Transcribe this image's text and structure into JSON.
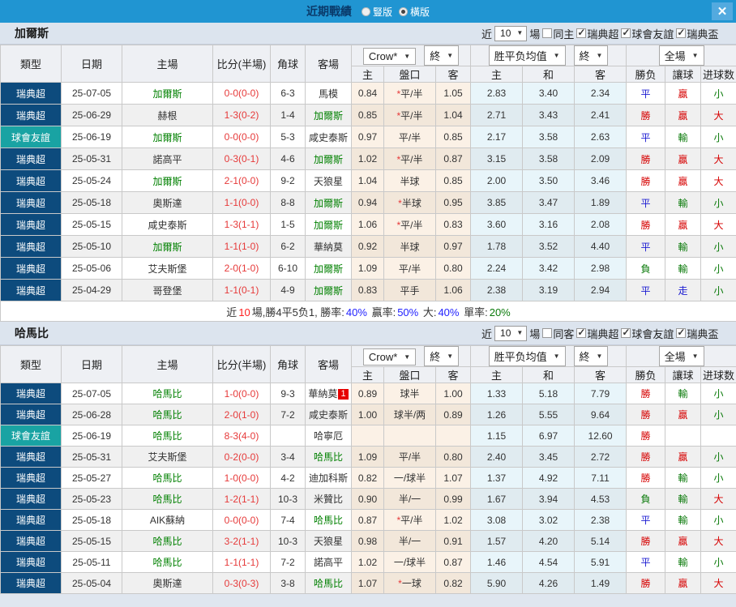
{
  "topbar": {
    "title": "近期戰績",
    "vertical": {
      "label": "豎版",
      "selected": false
    },
    "horizontal": {
      "label": "橫版",
      "selected": true
    },
    "close": "✕"
  },
  "colors": {
    "topbar_bg": "#2095d2",
    "league_super_bg": "#0d4b7d",
    "league_friendly_bg": "#19a3a3",
    "focus_team": "#008000",
    "score": "#e63939",
    "win_red": "#d60000",
    "draw_blue": "#1b1bd2",
    "lose_green": "#0a7a0a"
  },
  "table": {
    "near": "近",
    "matches": "10",
    "unit": "場",
    "odds_src": "Crow*",
    "final": "終",
    "avg": "胜平负均值",
    "scope": "全場",
    "cols": {
      "league": "類型",
      "date": "日期",
      "home": "主場",
      "score": "比分(半場)",
      "corners": "角球",
      "away": "客場",
      "o_home": "主",
      "o_line": "盤口",
      "o_away": "客",
      "a_home": "主",
      "a_draw": "和",
      "a_away": "客",
      "r_wdl": "勝负",
      "r_handicap": "讓球",
      "r_goals": "进球数"
    }
  },
  "sections": [
    {
      "team": "加爾斯",
      "same_side": "同主",
      "same_checked": false,
      "leagues": [
        {
          "label": "瑞典超",
          "checked": true
        },
        {
          "label": "球會友誼",
          "checked": true
        },
        {
          "label": "瑞典盃",
          "checked": true
        }
      ],
      "rows": [
        {
          "league": "瑞典超",
          "league_type": "super",
          "date": "25-07-05",
          "home": "加爾斯",
          "home_focus": true,
          "score": "0-0(0-0)",
          "corners": "6-3",
          "away": "馬模",
          "away_focus": false,
          "away_badge": "",
          "odds_home": "0.84",
          "line": "*平/半",
          "odds_away": "1.05",
          "avg_home": "2.83",
          "avg_draw": "3.40",
          "avg_away": "2.34",
          "r_wdl": "平",
          "r_wdl_color": "blue",
          "r_handicap": "贏",
          "r_handicap_color": "red",
          "r_goals": "小",
          "r_goals_color": "green"
        },
        {
          "league": "瑞典超",
          "league_type": "super",
          "date": "25-06-29",
          "home": "赫根",
          "home_focus": false,
          "score": "1-3(0-2)",
          "corners": "1-4",
          "away": "加爾斯",
          "away_focus": true,
          "away_badge": "",
          "odds_home": "0.85",
          "line": "*平/半",
          "odds_away": "1.04",
          "avg_home": "2.71",
          "avg_draw": "3.43",
          "avg_away": "2.41",
          "r_wdl": "勝",
          "r_wdl_color": "red",
          "r_handicap": "贏",
          "r_handicap_color": "red",
          "r_goals": "大",
          "r_goals_color": "red"
        },
        {
          "league": "球會友誼",
          "league_type": "friendly",
          "date": "25-06-19",
          "home": "加爾斯",
          "home_focus": true,
          "score": "0-0(0-0)",
          "corners": "5-3",
          "away": "咸史泰斯",
          "away_focus": false,
          "away_badge": "",
          "odds_home": "0.97",
          "line": "平/半",
          "odds_away": "0.85",
          "avg_home": "2.17",
          "avg_draw": "3.58",
          "avg_away": "2.63",
          "r_wdl": "平",
          "r_wdl_color": "blue",
          "r_handicap": "輸",
          "r_handicap_color": "green",
          "r_goals": "小",
          "r_goals_color": "green"
        },
        {
          "league": "瑞典超",
          "league_type": "super",
          "date": "25-05-31",
          "home": "諾高平",
          "home_focus": false,
          "score": "0-3(0-1)",
          "corners": "4-6",
          "away": "加爾斯",
          "away_focus": true,
          "away_badge": "",
          "odds_home": "1.02",
          "line": "*平/半",
          "odds_away": "0.87",
          "avg_home": "3.15",
          "avg_draw": "3.58",
          "avg_away": "2.09",
          "r_wdl": "勝",
          "r_wdl_color": "red",
          "r_handicap": "贏",
          "r_handicap_color": "red",
          "r_goals": "大",
          "r_goals_color": "red"
        },
        {
          "league": "瑞典超",
          "league_type": "super",
          "date": "25-05-24",
          "home": "加爾斯",
          "home_focus": true,
          "score": "2-1(0-0)",
          "corners": "9-2",
          "away": "天狼星",
          "away_focus": false,
          "away_badge": "",
          "odds_home": "1.04",
          "line": "半球",
          "odds_away": "0.85",
          "avg_home": "2.00",
          "avg_draw": "3.50",
          "avg_away": "3.46",
          "r_wdl": "勝",
          "r_wdl_color": "red",
          "r_handicap": "贏",
          "r_handicap_color": "red",
          "r_goals": "大",
          "r_goals_color": "red"
        },
        {
          "league": "瑞典超",
          "league_type": "super",
          "date": "25-05-18",
          "home": "奧斯達",
          "home_focus": false,
          "score": "1-1(0-0)",
          "corners": "8-8",
          "away": "加爾斯",
          "away_focus": true,
          "away_badge": "",
          "odds_home": "0.94",
          "line": "*半球",
          "odds_away": "0.95",
          "avg_home": "3.85",
          "avg_draw": "3.47",
          "avg_away": "1.89",
          "r_wdl": "平",
          "r_wdl_color": "blue",
          "r_handicap": "輸",
          "r_handicap_color": "green",
          "r_goals": "小",
          "r_goals_color": "green"
        },
        {
          "league": "瑞典超",
          "league_type": "super",
          "date": "25-05-15",
          "home": "咸史泰斯",
          "home_focus": false,
          "score": "1-3(1-1)",
          "corners": "1-5",
          "away": "加爾斯",
          "away_focus": true,
          "away_badge": "",
          "odds_home": "1.06",
          "line": "*平/半",
          "odds_away": "0.83",
          "avg_home": "3.60",
          "avg_draw": "3.16",
          "avg_away": "2.08",
          "r_wdl": "勝",
          "r_wdl_color": "red",
          "r_handicap": "贏",
          "r_handicap_color": "red",
          "r_goals": "大",
          "r_goals_color": "red"
        },
        {
          "league": "瑞典超",
          "league_type": "super",
          "date": "25-05-10",
          "home": "加爾斯",
          "home_focus": true,
          "score": "1-1(1-0)",
          "corners": "6-2",
          "away": "華納莫",
          "away_focus": false,
          "away_badge": "",
          "odds_home": "0.92",
          "line": "半球",
          "odds_away": "0.97",
          "avg_home": "1.78",
          "avg_draw": "3.52",
          "avg_away": "4.40",
          "r_wdl": "平",
          "r_wdl_color": "blue",
          "r_handicap": "輸",
          "r_handicap_color": "green",
          "r_goals": "小",
          "r_goals_color": "green"
        },
        {
          "league": "瑞典超",
          "league_type": "super",
          "date": "25-05-06",
          "home": "艾夫斯堡",
          "home_focus": false,
          "score": "2-0(1-0)",
          "corners": "6-10",
          "away": "加爾斯",
          "away_focus": true,
          "away_badge": "",
          "odds_home": "1.09",
          "line": "平/半",
          "odds_away": "0.80",
          "avg_home": "2.24",
          "avg_draw": "3.42",
          "avg_away": "2.98",
          "r_wdl": "負",
          "r_wdl_color": "green",
          "r_handicap": "輸",
          "r_handicap_color": "green",
          "r_goals": "小",
          "r_goals_color": "green"
        },
        {
          "league": "瑞典超",
          "league_type": "super",
          "date": "25-04-29",
          "home": "哥登堡",
          "home_focus": false,
          "score": "1-1(0-1)",
          "corners": "4-9",
          "away": "加爾斯",
          "away_focus": true,
          "away_badge": "",
          "odds_home": "0.83",
          "line": "平手",
          "odds_away": "1.06",
          "avg_home": "2.38",
          "avg_draw": "3.19",
          "avg_away": "2.94",
          "r_wdl": "平",
          "r_wdl_color": "blue",
          "r_handicap": "走",
          "r_handicap_color": "blue",
          "r_goals": "小",
          "r_goals_color": "green"
        }
      ],
      "summary": [
        {
          "text": "近",
          "color": "#333333"
        },
        {
          "text": "10",
          "color": "#ff2020"
        },
        {
          "text": "場,勝4平5负1, 勝率:",
          "color": "#333333"
        },
        {
          "text": "40%",
          "color": "#2222ff"
        },
        {
          "text": " 贏率:",
          "color": "#333333"
        },
        {
          "text": "50%",
          "color": "#2222ff"
        },
        {
          "text": " 大:",
          "color": "#333333"
        },
        {
          "text": "40%",
          "color": "#2222ff"
        },
        {
          "text": " 單率:",
          "color": "#333333"
        },
        {
          "text": "20%",
          "color": "#0a7a0a"
        }
      ]
    },
    {
      "team": "哈馬比",
      "same_side": "同客",
      "same_checked": false,
      "leagues": [
        {
          "label": "瑞典超",
          "checked": true
        },
        {
          "label": "球會友誼",
          "checked": true
        },
        {
          "label": "瑞典盃",
          "checked": true
        }
      ],
      "rows": [
        {
          "league": "瑞典超",
          "league_type": "super",
          "date": "25-07-05",
          "home": "哈馬比",
          "home_focus": true,
          "score": "1-0(0-0)",
          "corners": "9-3",
          "away": "華納莫",
          "away_focus": false,
          "away_badge": "1",
          "odds_home": "0.89",
          "line": "球半",
          "odds_away": "1.00",
          "avg_home": "1.33",
          "avg_draw": "5.18",
          "avg_away": "7.79",
          "r_wdl": "勝",
          "r_wdl_color": "red",
          "r_handicap": "輸",
          "r_handicap_color": "green",
          "r_goals": "小",
          "r_goals_color": "green"
        },
        {
          "league": "瑞典超",
          "league_type": "super",
          "date": "25-06-28",
          "home": "哈馬比",
          "home_focus": true,
          "score": "2-0(1-0)",
          "corners": "7-2",
          "away": "咸史泰斯",
          "away_focus": false,
          "away_badge": "",
          "odds_home": "1.00",
          "line": "球半/两",
          "odds_away": "0.89",
          "avg_home": "1.26",
          "avg_draw": "5.55",
          "avg_away": "9.64",
          "r_wdl": "勝",
          "r_wdl_color": "red",
          "r_handicap": "贏",
          "r_handicap_color": "red",
          "r_goals": "小",
          "r_goals_color": "green"
        },
        {
          "league": "球會友誼",
          "league_type": "friendly",
          "date": "25-06-19",
          "home": "哈馬比",
          "home_focus": true,
          "score": "8-3(4-0)",
          "corners": "",
          "away": "哈寧厄",
          "away_focus": false,
          "away_badge": "",
          "odds_home": "",
          "line": "",
          "odds_away": "",
          "avg_home": "1.15",
          "avg_draw": "6.97",
          "avg_away": "12.60",
          "r_wdl": "勝",
          "r_wdl_color": "red",
          "r_handicap": "",
          "r_handicap_color": "",
          "r_goals": "",
          "r_goals_color": ""
        },
        {
          "league": "瑞典超",
          "league_type": "super",
          "date": "25-05-31",
          "home": "艾夫斯堡",
          "home_focus": false,
          "score": "0-2(0-0)",
          "corners": "3-4",
          "away": "哈馬比",
          "away_focus": true,
          "away_badge": "",
          "odds_home": "1.09",
          "line": "平/半",
          "odds_away": "0.80",
          "avg_home": "2.40",
          "avg_draw": "3.45",
          "avg_away": "2.72",
          "r_wdl": "勝",
          "r_wdl_color": "red",
          "r_handicap": "贏",
          "r_handicap_color": "red",
          "r_goals": "小",
          "r_goals_color": "green"
        },
        {
          "league": "瑞典超",
          "league_type": "super",
          "date": "25-05-27",
          "home": "哈馬比",
          "home_focus": true,
          "score": "1-0(0-0)",
          "corners": "4-2",
          "away": "迪加科斯",
          "away_focus": false,
          "away_badge": "",
          "odds_home": "0.82",
          "line": "一/球半",
          "odds_away": "1.07",
          "avg_home": "1.37",
          "avg_draw": "4.92",
          "avg_away": "7.11",
          "r_wdl": "勝",
          "r_wdl_color": "red",
          "r_handicap": "輸",
          "r_handicap_color": "green",
          "r_goals": "小",
          "r_goals_color": "green"
        },
        {
          "league": "瑞典超",
          "league_type": "super",
          "date": "25-05-23",
          "home": "哈馬比",
          "home_focus": true,
          "score": "1-2(1-1)",
          "corners": "10-3",
          "away": "米贊比",
          "away_focus": false,
          "away_badge": "",
          "odds_home": "0.90",
          "line": "半/一",
          "odds_away": "0.99",
          "avg_home": "1.67",
          "avg_draw": "3.94",
          "avg_away": "4.53",
          "r_wdl": "負",
          "r_wdl_color": "green",
          "r_handicap": "輸",
          "r_handicap_color": "green",
          "r_goals": "大",
          "r_goals_color": "red"
        },
        {
          "league": "瑞典超",
          "league_type": "super",
          "date": "25-05-18",
          "home": "AIK蘇納",
          "home_focus": false,
          "score": "0-0(0-0)",
          "corners": "7-4",
          "away": "哈馬比",
          "away_focus": true,
          "away_badge": "",
          "odds_home": "0.87",
          "line": "*平/半",
          "odds_away": "1.02",
          "avg_home": "3.08",
          "avg_draw": "3.02",
          "avg_away": "2.38",
          "r_wdl": "平",
          "r_wdl_color": "blue",
          "r_handicap": "輸",
          "r_handicap_color": "green",
          "r_goals": "小",
          "r_goals_color": "green"
        },
        {
          "league": "瑞典超",
          "league_type": "super",
          "date": "25-05-15",
          "home": "哈馬比",
          "home_focus": true,
          "score": "3-2(1-1)",
          "corners": "10-3",
          "away": "天狼星",
          "away_focus": false,
          "away_badge": "",
          "odds_home": "0.98",
          "line": "半/一",
          "odds_away": "0.91",
          "avg_home": "1.57",
          "avg_draw": "4.20",
          "avg_away": "5.14",
          "r_wdl": "勝",
          "r_wdl_color": "red",
          "r_handicap": "贏",
          "r_handicap_color": "red",
          "r_goals": "大",
          "r_goals_color": "red"
        },
        {
          "league": "瑞典超",
          "league_type": "super",
          "date": "25-05-11",
          "home": "哈馬比",
          "home_focus": true,
          "score": "1-1(1-1)",
          "corners": "7-2",
          "away": "諾高平",
          "away_focus": false,
          "away_badge": "",
          "odds_home": "1.02",
          "line": "一/球半",
          "odds_away": "0.87",
          "avg_home": "1.46",
          "avg_draw": "4.54",
          "avg_away": "5.91",
          "r_wdl": "平",
          "r_wdl_color": "blue",
          "r_handicap": "輸",
          "r_handicap_color": "green",
          "r_goals": "小",
          "r_goals_color": "green"
        },
        {
          "league": "瑞典超",
          "league_type": "super",
          "date": "25-05-04",
          "home": "奧斯達",
          "home_focus": false,
          "score": "0-3(0-3)",
          "corners": "3-8",
          "away": "哈馬比",
          "away_focus": true,
          "away_badge": "",
          "odds_home": "1.07",
          "line": "*一球",
          "odds_away": "0.82",
          "avg_home": "5.90",
          "avg_draw": "4.26",
          "avg_away": "1.49",
          "r_wdl": "勝",
          "r_wdl_color": "red",
          "r_handicap": "贏",
          "r_handicap_color": "red",
          "r_goals": "大",
          "r_goals_color": "red"
        }
      ],
      "summary": null
    }
  ]
}
